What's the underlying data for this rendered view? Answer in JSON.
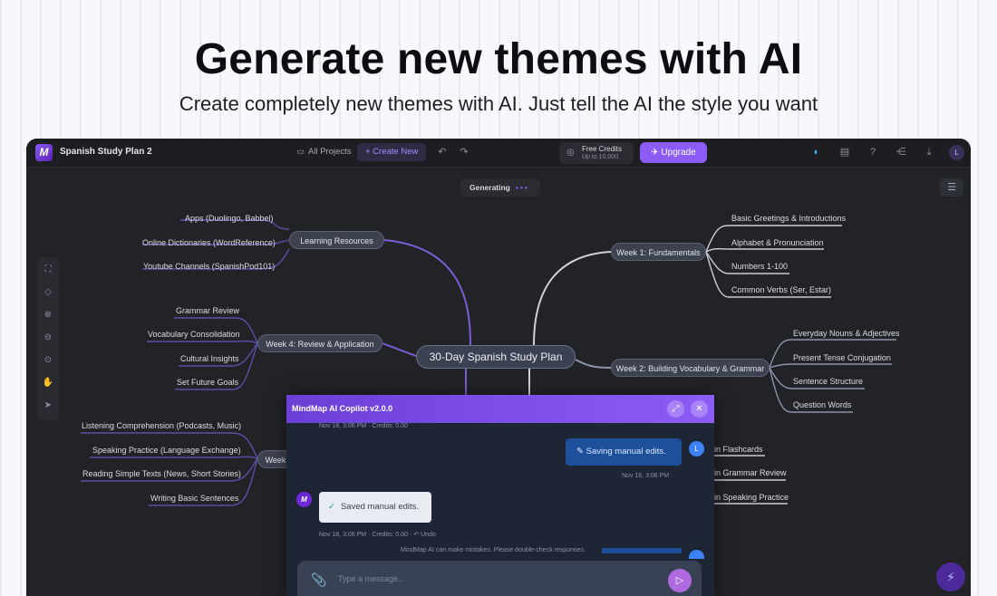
{
  "hero": {
    "title": "Generate new themes with AI",
    "subtitle": "Create completely new themes with AI. Just tell the AI the style you want"
  },
  "topbar": {
    "logo_letter": "M",
    "doc_title": "Spanish Study Plan 2",
    "all_projects": "All Projects",
    "create_new": "+ Create New",
    "credits_label": "Free Credits",
    "credits_value": "Up to 10,000",
    "upgrade": "Upgrade",
    "avatar": "L"
  },
  "canvas": {
    "generating": "Generating",
    "root": "30-Day Spanish Study Plan",
    "branches": {
      "learning_resources": {
        "label": "Learning Resources",
        "items": [
          "Apps (Duolingo, Babbel)",
          "Online Dictionaries (WordReference)",
          "Youtube Channels (SpanishPod101)"
        ]
      },
      "week4": {
        "label": "Week 4: Review & Application",
        "items": [
          "Grammar Review",
          "Vocabulary Consolidation",
          "Cultural Insights",
          "Set Future Goals"
        ]
      },
      "week3": {
        "label": "Week",
        "items": [
          "Listening Comprehension (Podcasts, Music)",
          "Speaking Practice (Language Exchange)",
          "Reading Simple Texts (News, Short Stories)",
          "Writing Basic Sentences"
        ]
      },
      "week1": {
        "label": "Week 1: Fundamentals",
        "items": [
          "Basic Greetings & Introductions",
          "Alphabet & Pronunciation",
          "Numbers 1-100",
          "Common Verbs (Ser, Estar)"
        ]
      },
      "week2": {
        "label": "Week 2: Building Vocabulary & Grammar",
        "items": [
          "Everyday Nouns & Adjectives",
          "Present Tense Conjugation",
          "Sentence Structure",
          "Question Words"
        ]
      },
      "right_lower": {
        "items": [
          "in Flashcards",
          "in Grammar Review",
          "in Speaking Practice"
        ]
      }
    }
  },
  "copilot": {
    "title": "MindMap AI Copilot v2.0.0",
    "meta_top": "Nov 18, 3:06 PM  ·  Credits: 0.00",
    "user_message": "Saving manual edits.",
    "user_avatar": "L",
    "user_meta": "Nov 18, 3:06 PM",
    "bot_avatar": "M",
    "bot_message": "Saved manual edits.",
    "bot_meta": "Nov 18, 3:06 PM  ·  Credits: 0.00  ·  ↶ Undo",
    "disclaimer": "MindMap AI can make mistakes. Please double-check responses.",
    "input_placeholder": "Type a message..."
  },
  "colors": {
    "accent": "#8b5cf6",
    "canvas_bg": "#222327",
    "user_bubble": "#1e4f9a"
  }
}
